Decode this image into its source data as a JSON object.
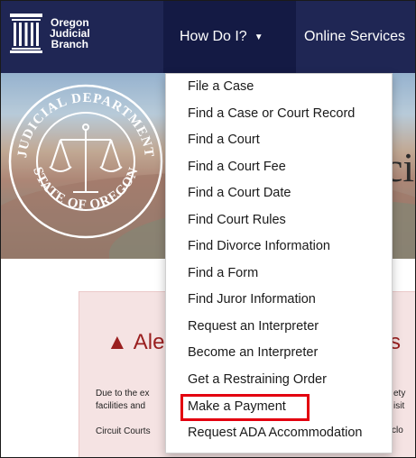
{
  "navbar": {
    "brand_line1": "Oregon",
    "brand_line2": "Judicial",
    "brand_line3": "Branch",
    "how_do_i": "How Do I?",
    "online_services": "Online Services"
  },
  "hero": {
    "seal_top": "JUDICIAL DEPARTMENT",
    "seal_bottom": "STATE OF OREGON",
    "title_fragment": "ci"
  },
  "alert": {
    "title_left": "Ale",
    "title_right": "s",
    "line1_left": "Due to the ex",
    "line1_right": "ety",
    "line2_left": "facilities and",
    "line2_right": "isit",
    "line3_left": "Circuit Courts",
    "line3_right": "clo"
  },
  "dropdown": {
    "items": [
      "File a Case",
      "Find a Case or Court Record",
      "Find a Court",
      "Find a Court Fee",
      "Find a Court Date",
      "Find Court Rules",
      "Find Divorce Information",
      "Find a Form",
      "Find Juror Information",
      "Request an Interpreter",
      "Become an Interpreter",
      "Get a Restraining Order",
      "Make a Payment",
      "Request ADA Accommodation"
    ]
  },
  "colors": {
    "navbar": "#1f2654",
    "navbar_active": "#141a44",
    "highlight_border": "#e3000f",
    "alert_bg": "#f5e3e3",
    "alert_text": "#9a1f1f"
  }
}
